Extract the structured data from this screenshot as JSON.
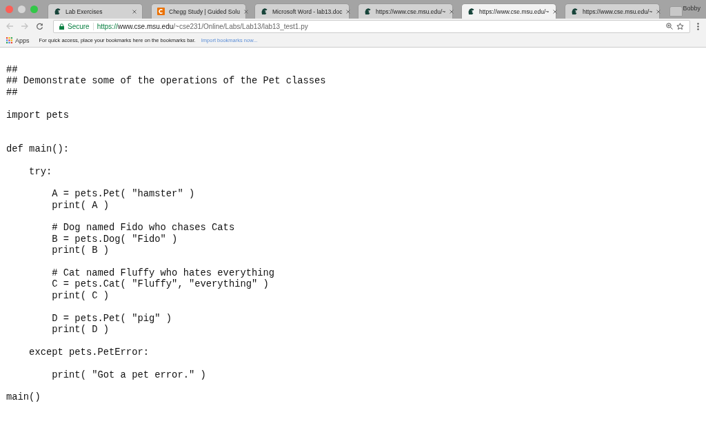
{
  "tabs": [
    {
      "title": "Lab Exercises",
      "kind": "helmet",
      "selected": false
    },
    {
      "title": "Chegg Study | Guided Solu",
      "kind": "square",
      "selected": false
    },
    {
      "title": "Microsoft Word - lab13.doc",
      "kind": "helmet",
      "selected": false
    },
    {
      "title": "https://www.cse.msu.edu/~",
      "kind": "helmet",
      "selected": false
    },
    {
      "title": "https://www.cse.msu.edu/~",
      "kind": "helmet",
      "selected": true
    },
    {
      "title": "https://www.cse.msu.edu/~",
      "kind": "helmet",
      "selected": false
    }
  ],
  "profile": "Bobby",
  "address_bar": {
    "security": "Secure",
    "scheme": "https://",
    "host": "www.cse.msu.edu",
    "path": "/~cse231/Online/Labs/Lab13/lab13_test1.py"
  },
  "bookmarks_bar": {
    "apps": "Apps",
    "hint": "For quick access, place your bookmarks here on the bookmarks bar.",
    "link": "Import bookmarks now..."
  },
  "code": "##\n## Demonstrate some of the operations of the Pet classes\n##\n\nimport pets\n\n\ndef main():\n\n    try:\n\n        A = pets.Pet( \"hamster\" )\n        print( A )\n\n        # Dog named Fido who chases Cats\n        B = pets.Dog( \"Fido\" )\n        print( B )\n\n        # Cat named Fluffy who hates everything\n        C = pets.Cat( \"Fluffy\", \"everything\" )\n        print( C )\n\n        D = pets.Pet( \"pig\" )\n        print( D )\n\n    except pets.PetError:\n\n        print( \"Got a pet error.\" )\n\nmain()"
}
